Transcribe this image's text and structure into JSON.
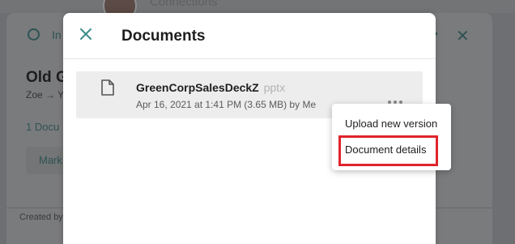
{
  "background": {
    "connections_label": "Connections",
    "status_label": "In",
    "page_title": "Old G",
    "owner_text": "Zoe → Y",
    "documents_link": "1 Docu",
    "action_button_label": "Mark",
    "created_by": "Created by",
    "more_icon": "ellipsis-icon",
    "close_icon": "close-icon"
  },
  "modal": {
    "title": "Documents",
    "close_icon": "close-icon",
    "accent_color": "#3a8c8c",
    "documents": [
      {
        "name": "GreenCorpSalesDeckZ",
        "extension": "pptx",
        "meta": "Apr 16, 2021 at 1:41 PM (3.65 MB) by Me",
        "icon": "file-icon",
        "more_icon": "more-horizontal-icon"
      }
    ]
  },
  "menu": {
    "items": [
      {
        "label": "Upload new version"
      },
      {
        "label": "Document details",
        "highlighted": true
      }
    ],
    "highlight_color": "#e0242c"
  }
}
